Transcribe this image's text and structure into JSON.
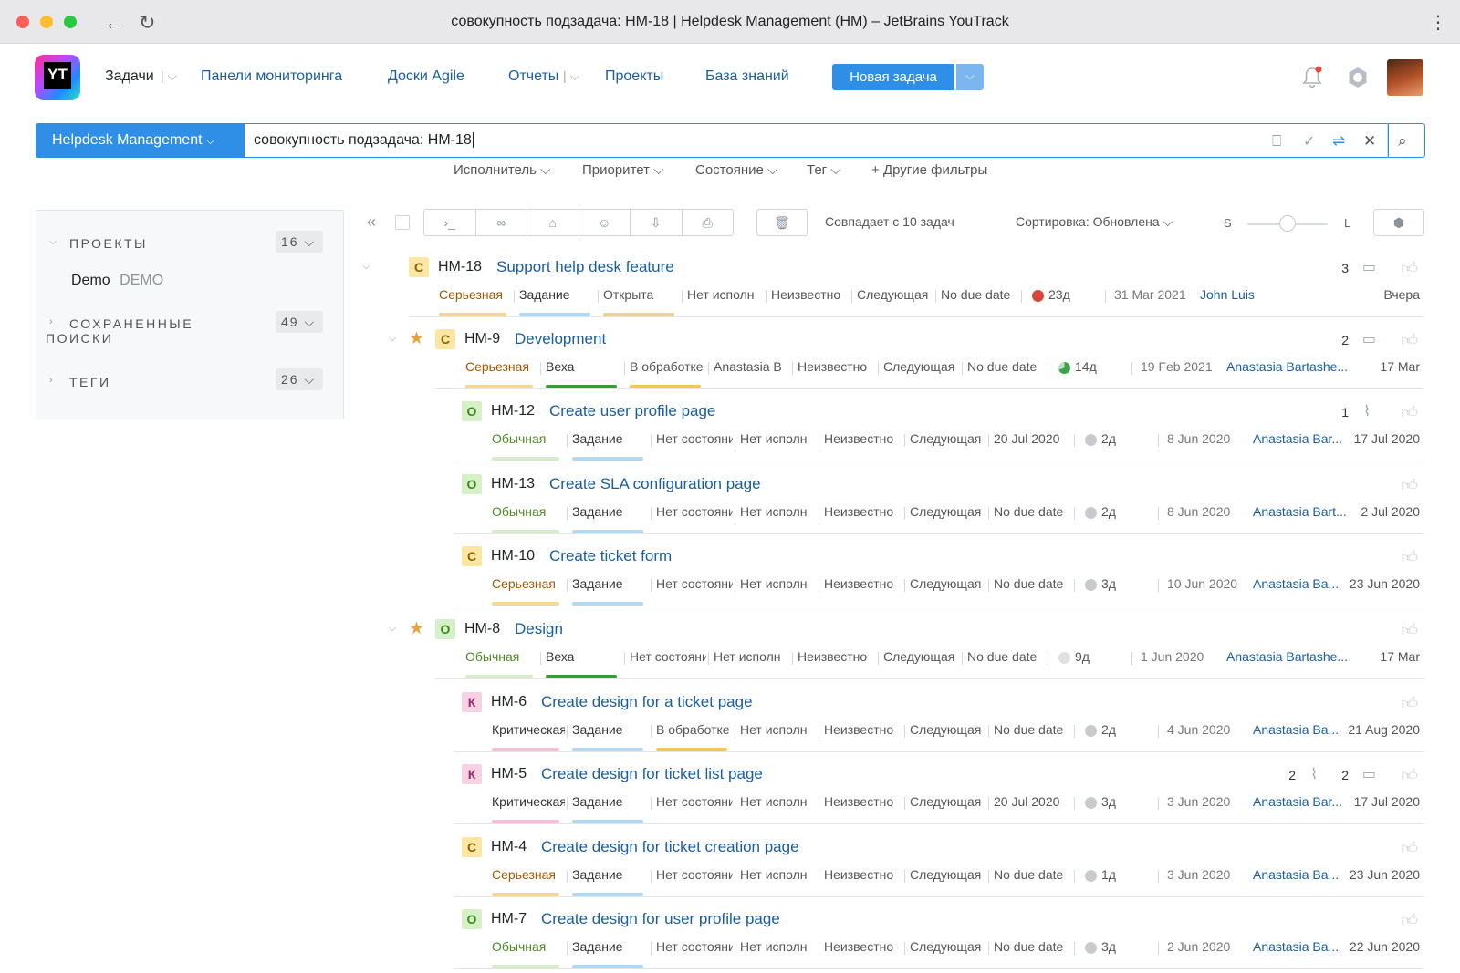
{
  "window": {
    "title": "совокупность подзадача: HM-18 | Helpdesk Management (HM) – JetBrains YouTrack"
  },
  "header": {
    "logo": "YT",
    "nav": [
      "Задачи",
      "Панели мониторинга",
      "Доски Agile",
      "Отчеты",
      "Проекты",
      "База знаний"
    ],
    "new_issue": "Новая задача"
  },
  "search": {
    "project": "Helpdesk Management",
    "query": "совокупность подзадача: HM-18"
  },
  "filters": [
    "Исполнитель",
    "Приоритет",
    "Состояние",
    "Тег",
    "Другие фильтры"
  ],
  "sidebar": {
    "projects_label": "ПРОЕКТЫ",
    "projects_count": "16",
    "project_name": "Demo",
    "project_key": "DEMO",
    "saved_label_1": "СОХРАНЕННЫЕ",
    "saved_label_2": "ПОИСКИ",
    "saved_count": "49",
    "tags_label": "ТЕГИ",
    "tags_count": "26"
  },
  "toolbar": {
    "match": "Совпадает с 10 задач",
    "sort": "Сортировка: Обновлена",
    "size_s": "S",
    "size_l": "L"
  },
  "issues": [
    {
      "id": "HM-18",
      "summary": "Support help desk feature",
      "prio": "С",
      "prio_label": "Серьезная",
      "type": "Задание",
      "state": "Открыта",
      "assignee_f": "Нет исполн",
      "f5": "Неизвестно",
      "f6": "Следующая",
      "due": "No due date",
      "est": "23д",
      "created": "31 Mar 2021",
      "assignee": "John Luis",
      "updated": "Вчера",
      "comments": "3",
      "attach": ""
    },
    {
      "id": "HM-9",
      "summary": "Development",
      "prio": "С",
      "prio_label": "Серьезная",
      "type": "Веха",
      "state": "В обработке",
      "assignee_f": "Anastasia B",
      "f5": "Неизвестно",
      "f6": "Следующая",
      "due": "No due date",
      "est": "14д",
      "created": "19 Feb 2021",
      "assignee": "Anastasia Bartashe...",
      "updated": "17 Mar",
      "comments": "2",
      "attach": ""
    },
    {
      "id": "HM-12",
      "summary": "Create user profile page",
      "prio": "О",
      "prio_label": "Обычная",
      "type": "Задание",
      "state": "Нет состояния",
      "assignee_f": "Нет исполн",
      "f5": "Неизвестно",
      "f6": "Следующая",
      "due": "20 Jul 2020",
      "est": "2д",
      "created": "8 Jun 2020",
      "assignee": "Anastasia Bar...",
      "updated": "17 Jul 2020",
      "comments": "",
      "attach": "1"
    },
    {
      "id": "HM-13",
      "summary": "Create SLA configuration page",
      "prio": "О",
      "prio_label": "Обычная",
      "type": "Задание",
      "state": "Нет состояния",
      "assignee_f": "Нет исполн",
      "f5": "Неизвестно",
      "f6": "Следующая",
      "due": "No due date",
      "est": "2д",
      "created": "8 Jun 2020",
      "assignee": "Anastasia Bart...",
      "updated": "2 Jul 2020",
      "comments": "",
      "attach": ""
    },
    {
      "id": "HM-10",
      "summary": "Create ticket form",
      "prio": "С",
      "prio_label": "Серьезная",
      "type": "Задание",
      "state": "Нет состояния",
      "assignee_f": "Нет исполн",
      "f5": "Неизвестно",
      "f6": "Следующая",
      "due": "No due date",
      "est": "3д",
      "created": "10 Jun 2020",
      "assignee": "Anastasia Ba...",
      "updated": "23 Jun 2020",
      "comments": "",
      "attach": ""
    },
    {
      "id": "HM-8",
      "summary": "Design",
      "prio": "О",
      "prio_label": "Обычная",
      "type": "Веха",
      "state": "Нет состояния",
      "assignee_f": "Нет исполн",
      "f5": "Неизвестно",
      "f6": "Следующая",
      "due": "No due date",
      "est": "9д",
      "created": "1 Jun 2020",
      "assignee": "Anastasia Bartashe...",
      "updated": "17 Mar",
      "comments": "",
      "attach": ""
    },
    {
      "id": "HM-6",
      "summary": "Create design for a ticket page",
      "prio": "К",
      "prio_label": "Критическая",
      "type": "Задание",
      "state": "В обработке",
      "assignee_f": "Нет исполн",
      "f5": "Неизвестно",
      "f6": "Следующая",
      "due": "No due date",
      "est": "2д",
      "created": "4 Jun 2020",
      "assignee": "Anastasia Ba...",
      "updated": "21 Aug 2020",
      "comments": "",
      "attach": ""
    },
    {
      "id": "HM-5",
      "summary": "Create design for ticket list page",
      "prio": "К",
      "prio_label": "Критическая",
      "type": "Задание",
      "state": "Нет состояния",
      "assignee_f": "Нет исполн",
      "f5": "Неизвестно",
      "f6": "Следующая",
      "due": "20 Jul 2020",
      "est": "3д",
      "created": "3 Jun 2020",
      "assignee": "Anastasia Bar...",
      "updated": "17 Jul 2020",
      "comments": "2",
      "attach": "2"
    },
    {
      "id": "HM-4",
      "summary": "Create design for ticket creation page",
      "prio": "С",
      "prio_label": "Серьезная",
      "type": "Задание",
      "state": "Нет состояния",
      "assignee_f": "Нет исполн",
      "f5": "Неизвестно",
      "f6": "Следующая",
      "due": "No due date",
      "est": "1д",
      "created": "3 Jun 2020",
      "assignee": "Anastasia Ba...",
      "updated": "23 Jun 2020",
      "comments": "",
      "attach": ""
    },
    {
      "id": "HM-7",
      "summary": "Create design for user profile page",
      "prio": "О",
      "prio_label": "Обычная",
      "type": "Задание",
      "state": "Нет состояния",
      "assignee_f": "Нет исполн",
      "f5": "Неизвестно",
      "f6": "Следующая",
      "due": "No due date",
      "est": "3д",
      "created": "2 Jun 2020",
      "assignee": "Anastasia Ba...",
      "updated": "22 Jun 2020",
      "comments": "",
      "attach": ""
    }
  ],
  "colors": {
    "accent": "#2f8ee5",
    "link": "#1a5ea0",
    "star": "#e8a33d",
    "estimate_red": "#d9453b"
  }
}
